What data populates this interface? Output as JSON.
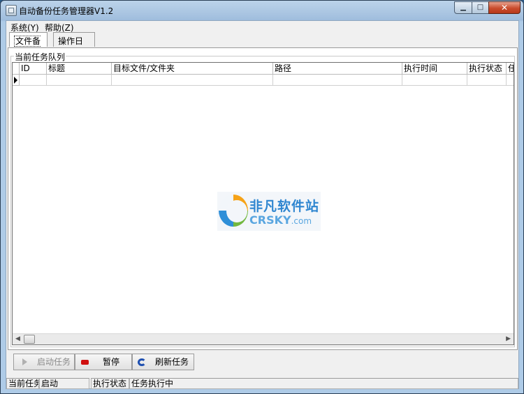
{
  "window": {
    "title": "自动备份任务管理器V1.2",
    "min_label": "▁",
    "max_label": "□",
    "close_label": "✕"
  },
  "menu": [
    "系统(Y)",
    "帮助(Z)"
  ],
  "tabs": [
    {
      "label": "文件备份",
      "active": true
    },
    {
      "label": "操作日志",
      "active": false
    }
  ],
  "panel": {
    "group_label": "当前任务队列",
    "columns": [
      "ID",
      "标题",
      "目标文件/文件夹",
      "路径",
      "执行时间",
      "执行状态",
      "任"
    ]
  },
  "watermark": {
    "cn": "非凡软件站",
    "en": "CRSKY",
    "en_suffix": ".com"
  },
  "toolbar": {
    "start_label": "启动任务",
    "pause_label": "暂停",
    "refresh_label": "刷新任务"
  },
  "status": {
    "current_task_label": "当前任务",
    "current_task_value": "启动",
    "exec_status_label": "执行状态",
    "exec_status_value": "任务执行中"
  },
  "colors": {
    "pause_icon": "#d01010",
    "refresh_icon": "#1e4fb0"
  }
}
